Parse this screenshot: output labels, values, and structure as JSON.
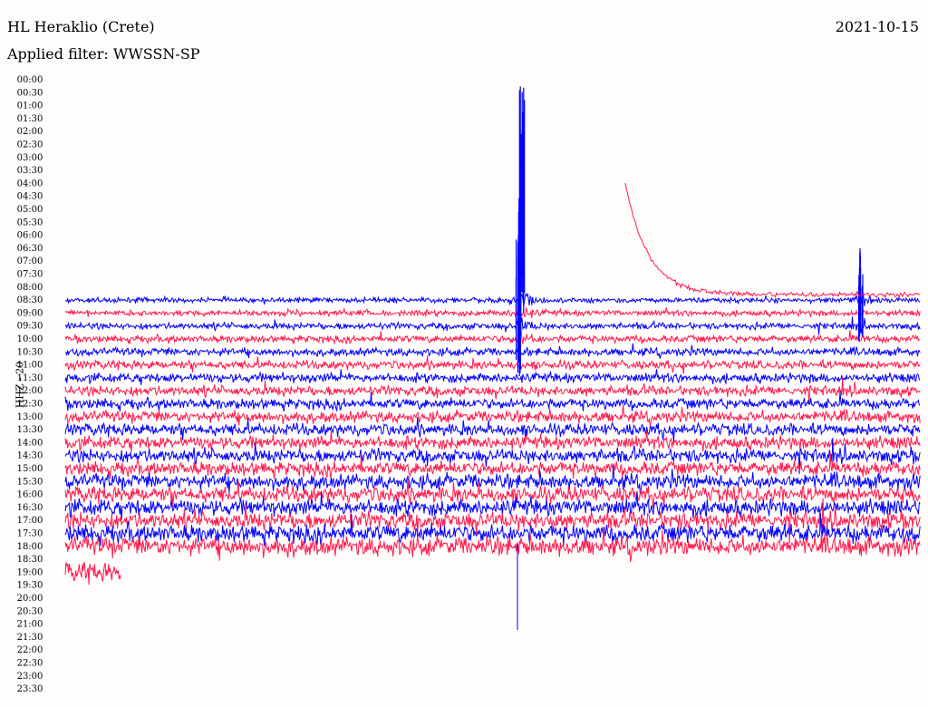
{
  "header": {
    "station": "HL Heraklio (Crete)",
    "filter": "Applied filter: WWSSN-SP",
    "date": "2021-10-15",
    "channel": "HHZ - 20"
  },
  "colors": {
    "background": "#fffcfc",
    "trace_a": "#0000ff",
    "trace_b": "#ff1a4b",
    "text": "#000000"
  },
  "chart_data": {
    "type": "line",
    "time_labels": [
      "00:00",
      "00:30",
      "01:00",
      "01:30",
      "02:00",
      "02:30",
      "03:00",
      "03:30",
      "04:00",
      "04:30",
      "05:00",
      "05:30",
      "06:00",
      "06:30",
      "07:00",
      "07:30",
      "08:00",
      "08:30",
      "09:00",
      "09:30",
      "10:00",
      "10:30",
      "11:00",
      "11:30",
      "12:00",
      "12:30",
      "13:00",
      "13:30",
      "14:00",
      "14:30",
      "15:00",
      "15:30",
      "16:00",
      "16:30",
      "17:00",
      "17:30",
      "18:00",
      "18:30",
      "19:00",
      "19:30",
      "20:00",
      "20:30",
      "21:00",
      "21:30",
      "22:00",
      "22:30",
      "23:00",
      "23:30"
    ],
    "first_trace_line": "08:30",
    "last_trace_line": "18:00",
    "partial_line": "19:00",
    "events": [
      {
        "line": "09:00",
        "minute": 15.8,
        "peak": 1.0
      },
      {
        "line": "09:00",
        "minute": 26.5,
        "peak": 0.6
      }
    ],
    "series": [
      {
        "color": "#0000ff"
      },
      {
        "color": "#ff1a4b"
      }
    ]
  }
}
